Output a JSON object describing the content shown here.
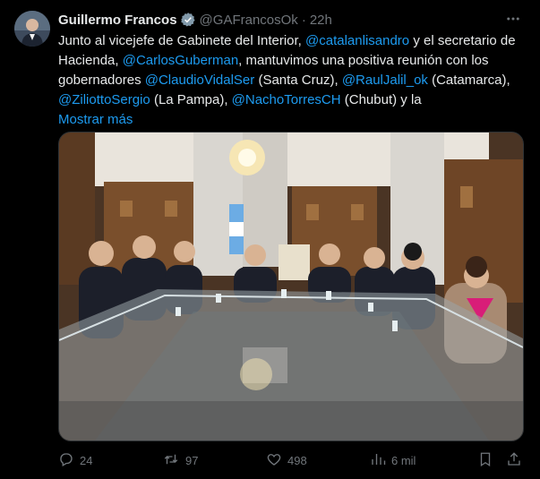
{
  "author": {
    "name": "Guillermo Francos",
    "handle": "@GAFrancosOk",
    "separator": "·",
    "time": "22h"
  },
  "body": {
    "segments": [
      {
        "text": "Junto al vicejefe de Gabinete del Interior, ",
        "type": "text"
      },
      {
        "text": "@catalanlisandro",
        "type": "mention"
      },
      {
        "text": " y el secretario de Hacienda, ",
        "type": "text"
      },
      {
        "text": "@CarlosGuberman",
        "type": "mention"
      },
      {
        "text": ", mantuvimos una positiva reunión con los gobernadores ",
        "type": "text"
      },
      {
        "text": "@ClaudioVidalSer",
        "type": "mention"
      },
      {
        "text": " (Santa Cruz), ",
        "type": "text"
      },
      {
        "text": "@RaulJalil_ok",
        "type": "mention"
      },
      {
        "text": " (Catamarca), ",
        "type": "text"
      },
      {
        "text": "@ZiliottoSergio",
        "type": "mention"
      },
      {
        "text": " (La Pampa), ",
        "type": "text"
      },
      {
        "text": "@NachoTorresCH",
        "type": "mention"
      },
      {
        "text": " (Chubut) y la",
        "type": "text"
      }
    ],
    "show_more": "Mostrar más"
  },
  "actions": {
    "replies": "24",
    "reposts": "97",
    "likes": "498",
    "views": "6 mil"
  },
  "colors": {
    "background": "#000000",
    "text": "#e7e9ea",
    "muted": "#71767b",
    "accent": "#1d9bf0"
  },
  "icons": [
    "verified-badge-icon",
    "more-options-icon",
    "reply-icon",
    "repost-icon",
    "like-icon",
    "views-icon",
    "bookmark-icon",
    "share-icon"
  ]
}
